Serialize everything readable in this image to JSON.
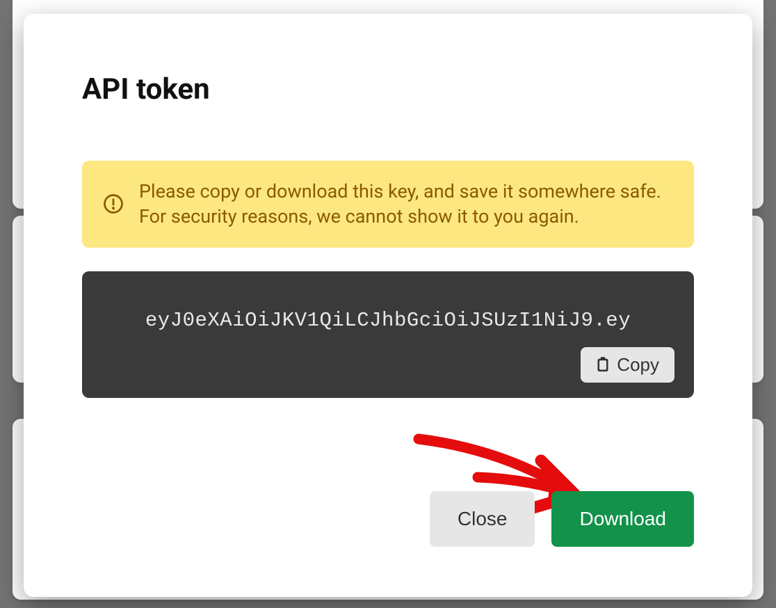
{
  "modal": {
    "title": "API token",
    "warning": {
      "text": "Please copy or download this key, and save it somewhere safe. For security reasons, we cannot show it to you again."
    },
    "token": {
      "value": "eyJ0eXAiOiJKV1QiLCJhbGciOiJSUzI1NiJ9.ey",
      "copy_label": "Copy"
    },
    "actions": {
      "close_label": "Close",
      "download_label": "Download"
    }
  },
  "colors": {
    "warning_bg": "#fde780",
    "warning_text": "#8a5a00",
    "token_bg": "#3a3a3a",
    "download_bg": "#12924a"
  }
}
